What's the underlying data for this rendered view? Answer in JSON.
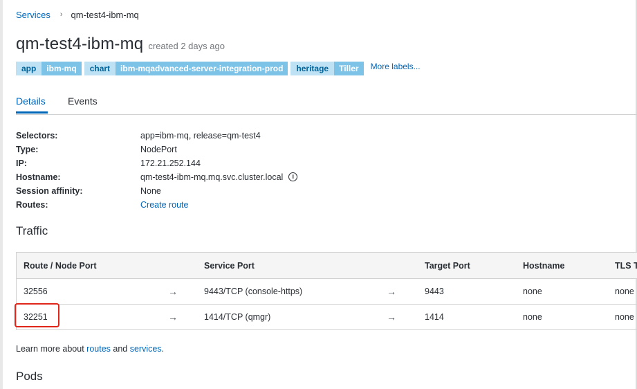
{
  "breadcrumb": {
    "parent": "Services",
    "separator": "›",
    "current": "qm-test4-ibm-mq"
  },
  "header": {
    "title": "qm-test4-ibm-mq",
    "created": "created 2 days ago"
  },
  "labels": [
    {
      "key": "app",
      "value": "ibm-mq"
    },
    {
      "key": "chart",
      "value": "ibm-mqadvanced-server-integration-prod"
    },
    {
      "key": "heritage",
      "value": "Tiller"
    }
  ],
  "more_labels": "More labels...",
  "tabs": [
    {
      "label": "Details",
      "active": true
    },
    {
      "label": "Events",
      "active": false
    }
  ],
  "details": {
    "selectors_label": "Selectors:",
    "selectors_value": "app=ibm-mq, release=qm-test4",
    "type_label": "Type:",
    "type_value": "NodePort",
    "ip_label": "IP:",
    "ip_value": "172.21.252.144",
    "hostname_label": "Hostname:",
    "hostname_value": "qm-test4-ibm-mq.mq.svc.cluster.local",
    "session_label": "Session affinity:",
    "session_value": "None",
    "routes_label": "Routes:",
    "routes_value": "Create route"
  },
  "traffic": {
    "heading": "Traffic",
    "columns": [
      "Route / Node Port",
      "Service Port",
      "Target Port",
      "Hostname",
      "TLS Te"
    ],
    "arrow": "→",
    "rows": [
      {
        "node_port": "32556",
        "service_port": "9443/TCP (console-https)",
        "target_port": "9443",
        "hostname": "none",
        "tls": "none"
      },
      {
        "node_port": "32251",
        "service_port": "1414/TCP (qmgr)",
        "target_port": "1414",
        "hostname": "none",
        "tls": "none"
      }
    ]
  },
  "learn_more": {
    "prefix": "Learn more about ",
    "routes_link": "routes",
    "and": " and ",
    "services_link": "services",
    "suffix": "."
  },
  "pods": {
    "heading": "Pods"
  },
  "highlight_color": "#e0251b",
  "accent_color": "#0066b8"
}
